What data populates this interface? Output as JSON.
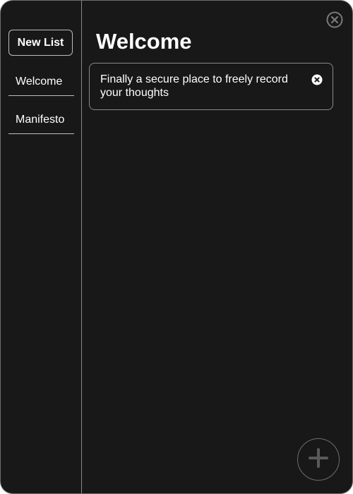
{
  "window": {
    "close_icon": "close-circle-icon"
  },
  "sidebar": {
    "new_list_label": "New List",
    "items": [
      {
        "label": "Welcome"
      },
      {
        "label": "Manifesto"
      }
    ]
  },
  "main": {
    "title": "Welcome",
    "entries": [
      {
        "text": "Finally a secure place to freely record your thoughts",
        "delete_icon": "delete-circle-icon"
      }
    ],
    "add_icon": "plus-icon"
  },
  "colors": {
    "background": "#181818",
    "text": "#ffffff",
    "border": "#bdbdbd",
    "muted_icon": "#7a7a7a"
  }
}
